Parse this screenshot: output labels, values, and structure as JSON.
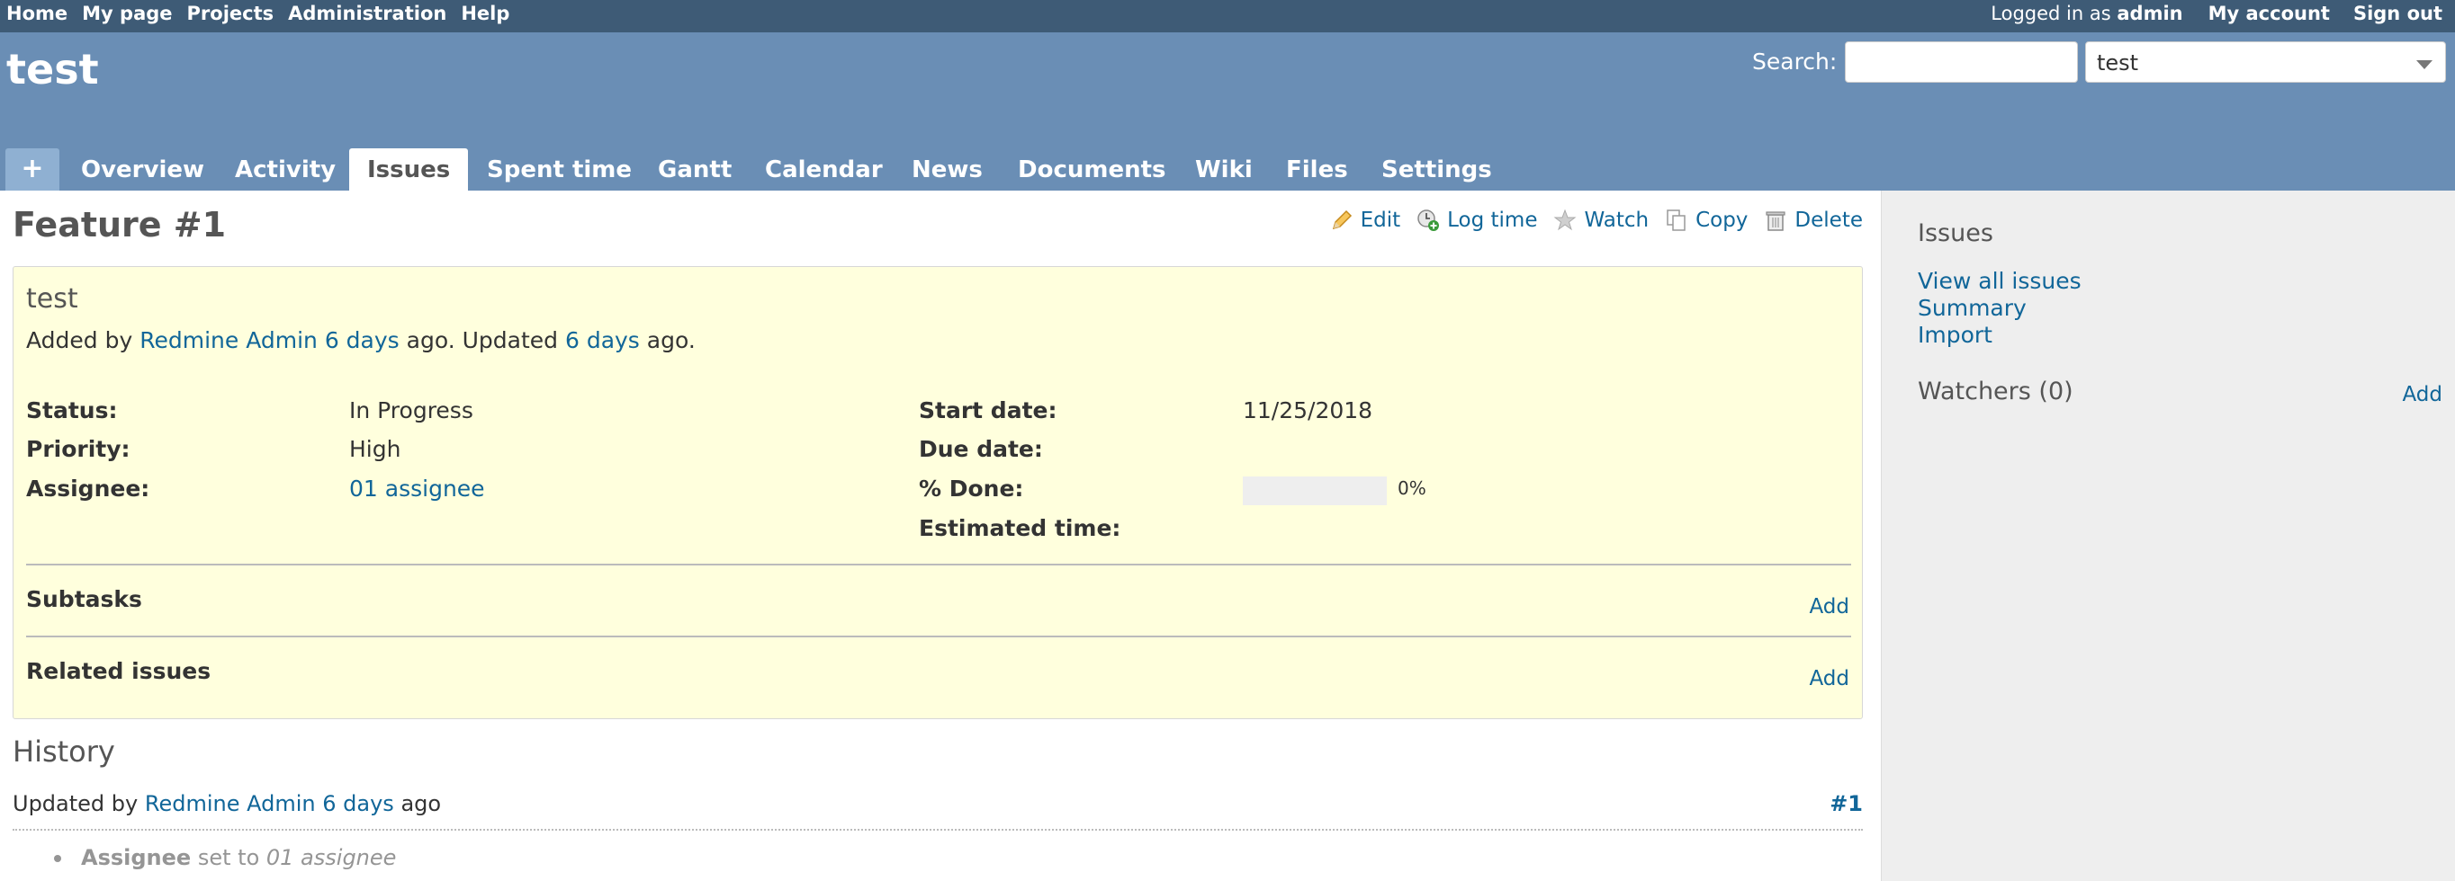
{
  "top_menu": {
    "left": [
      "Home",
      "My page",
      "Projects",
      "Administration",
      "Help"
    ],
    "logged_prefix": "Logged in as",
    "logged_user": "admin",
    "my_account": "My account",
    "sign_out": "Sign out"
  },
  "header": {
    "project_title": "test",
    "search_label": "Search:",
    "search_value": "",
    "project_select_value": "test"
  },
  "tabs": {
    "new": "+",
    "items": [
      "Overview",
      "Activity",
      "Issues",
      "Spent time",
      "Gantt",
      "Calendar",
      "News",
      "Documents",
      "Wiki",
      "Files",
      "Settings"
    ],
    "selected": "Issues"
  },
  "issue": {
    "heading": "Feature #1",
    "actions": {
      "edit": "Edit",
      "log_time": "Log time",
      "watch": "Watch",
      "copy": "Copy",
      "delete": "Delete"
    },
    "subject": "test",
    "author_line": {
      "added_by": "Added by",
      "author": "Redmine Admin",
      "added_ago": "6 days",
      "middle": "ago. Updated",
      "updated_ago": "6 days",
      "end": "ago."
    },
    "attributes": {
      "status_label": "Status:",
      "status": "In Progress",
      "priority_label": "Priority:",
      "priority": "High",
      "assignee_label": "Assignee:",
      "assignee": "01 assignee",
      "start_date_label": "Start date:",
      "start_date": "11/25/2018",
      "due_date_label": "Due date:",
      "due_date": "",
      "done_label": "% Done:",
      "done_pct_text": "0%",
      "done_fraction": 0,
      "estimated_label": "Estimated time:",
      "estimated": ""
    },
    "subtasks": {
      "title": "Subtasks",
      "add": "Add"
    },
    "related": {
      "title": "Related issues",
      "add": "Add"
    }
  },
  "history": {
    "title": "History",
    "journal": {
      "updated_by": "Updated by",
      "author": "Redmine Admin",
      "ago_link": "6 days",
      "ago": "ago",
      "number": "#1",
      "detail_field": "Assignee",
      "detail_mid": "set to",
      "detail_value": "01 assignee"
    }
  },
  "sidebar": {
    "issues_title": "Issues",
    "links": [
      "View all issues",
      "Summary",
      "Import"
    ],
    "watchers_title": "Watchers (0)",
    "watchers_add": "Add"
  },
  "colors": {
    "top_menu_bg": "#3e5b76",
    "header_bg": "#6a8eb5",
    "link": "#116699",
    "issue_bg": "#ffffdd",
    "sidebar_bg": "#eeeeee"
  }
}
